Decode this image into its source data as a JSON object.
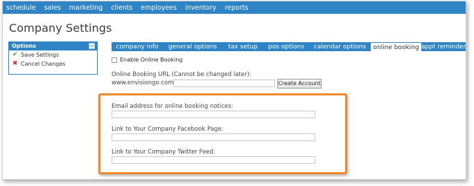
{
  "nav": {
    "items": [
      "schedule",
      "sales",
      "marketing",
      "clients",
      "employees",
      "inventory",
      "reports"
    ]
  },
  "page_title": "Company Settings",
  "options_panel": {
    "title": "Options",
    "collapse_glyph": "−",
    "save_label": "Save Settings",
    "cancel_label": "Cancel Changes"
  },
  "tabs": {
    "items": [
      "company info",
      "general options",
      "tax setup",
      "pos options",
      "calendar options",
      "online booking",
      "appt reminder"
    ],
    "active": "online booking"
  },
  "online_booking": {
    "enable_label": "Enable Online Booking",
    "enabled": false,
    "url_label": "Online Booking URL (Cannot be changed later):",
    "url_prefix": "www.envisiongo.com/a/",
    "url_value": "",
    "create_button": "Create Account",
    "email_label": "Email address for online booking notices:",
    "email_value": "",
    "facebook_label": "Link to Your Company Facebook Page:",
    "facebook_value": "",
    "twitter_label": "Link to Your Company Twitter Feed:",
    "twitter_value": ""
  },
  "colors": {
    "primary_blue": "#2f84c6",
    "highlight_orange": "#f0892a"
  },
  "icons": {
    "save": "check-icon",
    "cancel": "x-icon"
  }
}
